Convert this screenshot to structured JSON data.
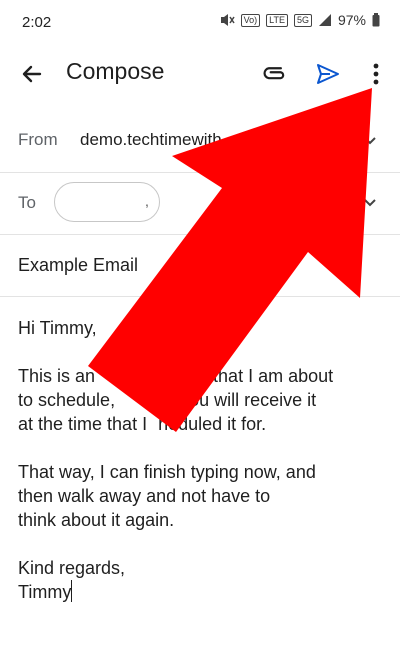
{
  "status_bar": {
    "time": "2:02",
    "network_labels": [
      "Vo)",
      "LTE",
      "5G"
    ],
    "battery": "97%"
  },
  "app_bar": {
    "title": "Compose",
    "icons": [
      "back-arrow-icon",
      "paperclip-icon",
      "send-icon",
      "more-vert-icon"
    ],
    "send_color": "#0b57d0"
  },
  "from": {
    "label": "From",
    "value": "demo.techtimewith"
  },
  "to": {
    "label": "To",
    "chip_mark": ","
  },
  "subject": "Example Email",
  "body": {
    "greeting": "Hi Timmy,",
    "paragraph1": [
      "This is an",
      "ll that I am about",
      "to schedule,",
      "you will receive it",
      "at the time that I",
      "heduled it for."
    ],
    "paragraph2": [
      "That way, I can finish typing now, and",
      "then walk away and not have to",
      "think about it again."
    ],
    "closing": [
      "Kind regards,",
      "Timmy"
    ]
  },
  "annotation": {
    "arrow_color": "#ff0000"
  }
}
